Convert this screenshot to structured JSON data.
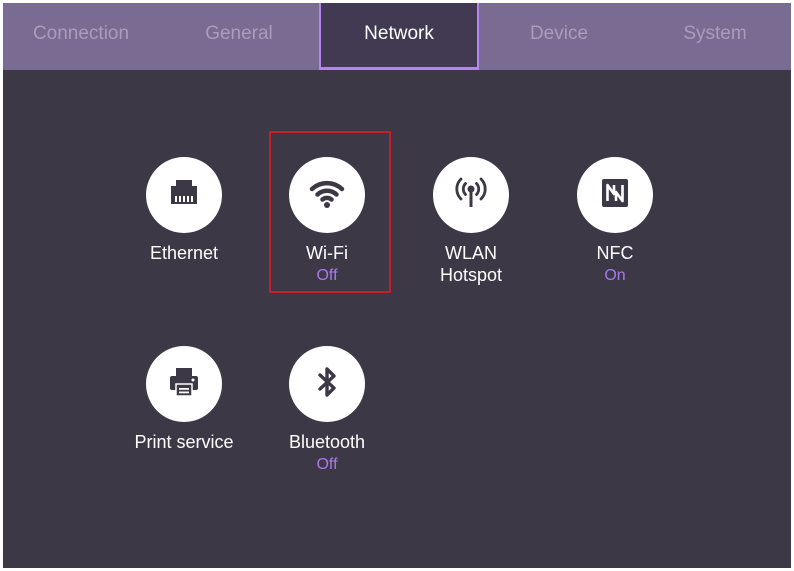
{
  "tabs": [
    {
      "label": "Connection"
    },
    {
      "label": "General"
    },
    {
      "label": "Network"
    },
    {
      "label": "Device"
    },
    {
      "label": "System"
    }
  ],
  "active_tab": "Network",
  "settings": {
    "ethernet": {
      "label": "Ethernet"
    },
    "wifi": {
      "label": "Wi-Fi",
      "status": "Off"
    },
    "wlan_hotspot": {
      "label_line1": "WLAN",
      "label_line2": "Hotspot"
    },
    "nfc": {
      "label": "NFC",
      "status": "On"
    },
    "print_service": {
      "label": "Print service"
    },
    "bluetooth": {
      "label": "Bluetooth",
      "status": "Off"
    }
  },
  "colors": {
    "background": "#3d3846",
    "tab_bar": "#7a6b93",
    "accent": "#b487f0",
    "status_text": "#a978f0",
    "highlight_box": "#c3202a"
  },
  "icons": {
    "ethernet": "ethernet-port-icon",
    "wifi": "wifi-icon",
    "wlan_hotspot": "hotspot-antenna-icon",
    "nfc": "nfc-icon",
    "print_service": "printer-icon",
    "bluetooth": "bluetooth-icon"
  }
}
